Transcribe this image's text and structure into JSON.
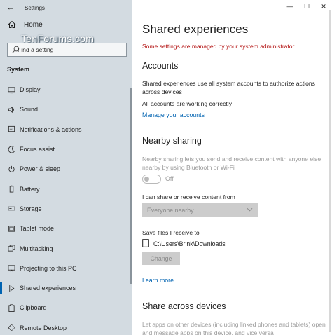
{
  "window": {
    "app_title": "Settings",
    "minimize_glyph": "—",
    "maximize_glyph": "☐",
    "close_glyph": "✕",
    "back_glyph": "←"
  },
  "watermark": "TenForums.com",
  "sidebar": {
    "home_label": "Home",
    "search_placeholder": "Find a setting",
    "section_label": "System",
    "items": [
      {
        "label": "Display",
        "icon": "display-icon"
      },
      {
        "label": "Sound",
        "icon": "sound-icon"
      },
      {
        "label": "Notifications & actions",
        "icon": "notifications-icon"
      },
      {
        "label": "Focus assist",
        "icon": "focus-assist-icon"
      },
      {
        "label": "Power & sleep",
        "icon": "power-icon"
      },
      {
        "label": "Battery",
        "icon": "battery-icon"
      },
      {
        "label": "Storage",
        "icon": "storage-icon"
      },
      {
        "label": "Tablet mode",
        "icon": "tablet-icon"
      },
      {
        "label": "Multitasking",
        "icon": "multitasking-icon"
      },
      {
        "label": "Projecting to this PC",
        "icon": "projecting-icon"
      },
      {
        "label": "Shared experiences",
        "icon": "shared-experiences-icon",
        "active": true
      },
      {
        "label": "Clipboard",
        "icon": "clipboard-icon"
      },
      {
        "label": "Remote Desktop",
        "icon": "remote-desktop-icon"
      }
    ]
  },
  "main": {
    "title": "Shared experiences",
    "admin_note": "Some settings are managed by your system administrator.",
    "accounts": {
      "heading": "Accounts",
      "description": "Shared experiences use all system accounts to authorize actions across devices",
      "status": "All accounts are working correctly",
      "manage_link": "Manage your accounts"
    },
    "nearby": {
      "heading": "Nearby sharing",
      "description": "Nearby sharing lets you send and receive content with anyone else nearby by using Bluetooth or Wi-Fi",
      "toggle_state": "Off",
      "share_label": "I can share or receive content from",
      "share_value": "Everyone nearby",
      "save_label": "Save files I receive to",
      "save_path": "C:\\Users\\Brink\\Downloads",
      "change_button": "Change"
    },
    "learn_more": "Learn more",
    "share_across": {
      "heading": "Share across devices",
      "description": "Let apps on other devices (including linked phones and tablets) open and message apps on this device, and vice versa"
    }
  },
  "colors": {
    "sidebar_bg": "#d3dbe1",
    "accent": "#0063b1",
    "admin_red": "#b31212",
    "disabled_text": "#9a9a9a"
  }
}
